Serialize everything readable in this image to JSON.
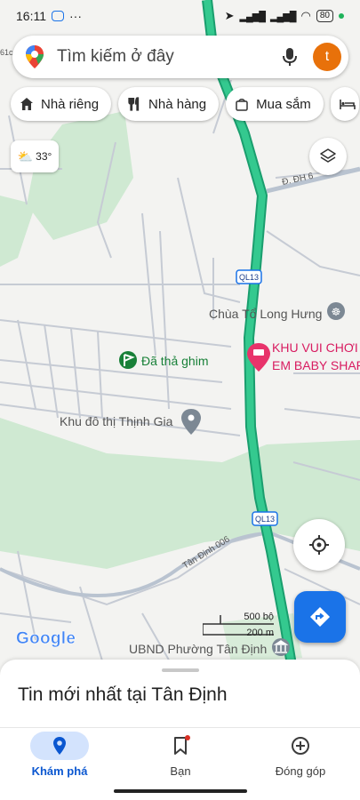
{
  "status_bar": {
    "time": "16:11",
    "battery": "80"
  },
  "search": {
    "placeholder": "Tìm kiếm ở đây",
    "avatar_letter": "t"
  },
  "chips": [
    {
      "label": "Nhà riêng",
      "icon": "home-icon"
    },
    {
      "label": "Nhà hàng",
      "icon": "restaurant-icon"
    },
    {
      "label": "Mua sắm",
      "icon": "shopping-icon"
    }
  ],
  "weather": {
    "temperature": "33°"
  },
  "map": {
    "labels": {
      "road_dh6": "Đ. ĐH 6",
      "route_ql13_a": "QL13",
      "route_ql13_b": "QL13",
      "pagoda": "Chùa Tổ Long Hưng",
      "playground_line1": "KHU VUI CHƠI",
      "playground_line2": "EM BABY SHAR",
      "dropped_pin": "Đã thả ghim",
      "urban_area": "Khu đô thị Thịnh Gia",
      "road_tandinh": "Tân Định 006",
      "ubnd": "UBND Phường Tân Định",
      "corner_top": "61c"
    }
  },
  "scale": {
    "imperial": "500 bộ",
    "metric": "200 m"
  },
  "google_logo": "Google",
  "sheet": {
    "title": "Tin mới nhất tại Tân Định"
  },
  "nav": {
    "explore": "Khám phá",
    "you": "Bạn",
    "contribute": "Đóng góp"
  },
  "colors": {
    "accent": "#1a73e8",
    "highway": "#2bbf8a",
    "park": "#cfe9d2"
  }
}
